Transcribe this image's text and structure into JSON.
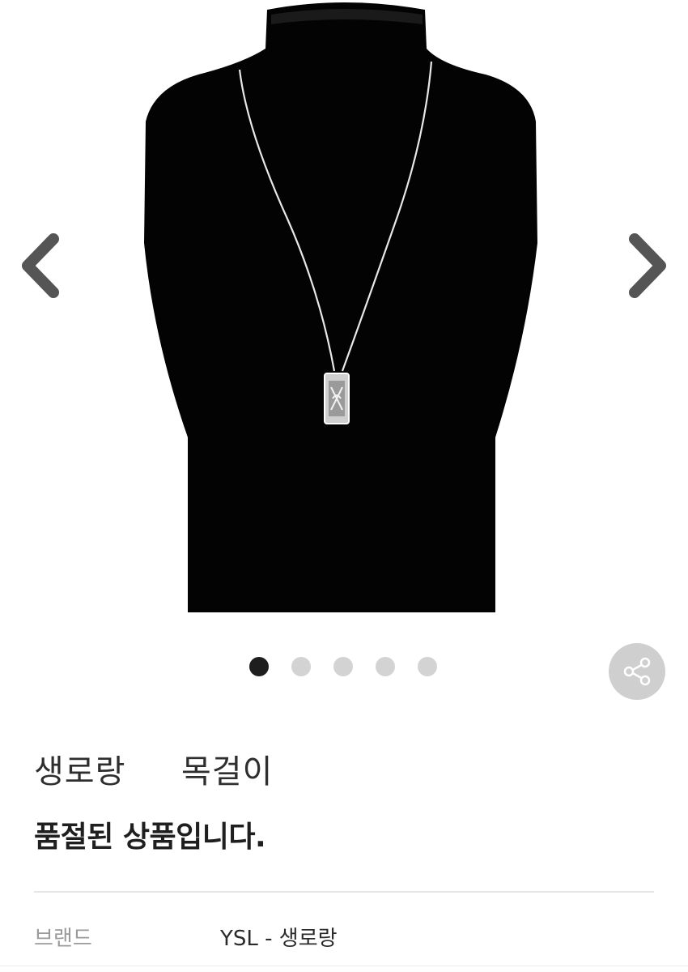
{
  "product": {
    "name": "생로랑     목걸이",
    "status": "품절된 상품입니다."
  },
  "gallery": {
    "image_count": 5,
    "active_index": 0,
    "image_alt": "YSL necklace on black velvet bust"
  },
  "info": {
    "brand_label": "브랜드",
    "brand_value": "YSL - 생로랑"
  },
  "icons": {
    "prev": "chevron-left-icon",
    "next": "chevron-right-icon",
    "share": "share-icon"
  },
  "colors": {
    "arrow": "#555555",
    "dot_active": "#1e1e1e",
    "dot_inactive": "#d3d3d3",
    "share_bg": "#cfcfcf"
  }
}
